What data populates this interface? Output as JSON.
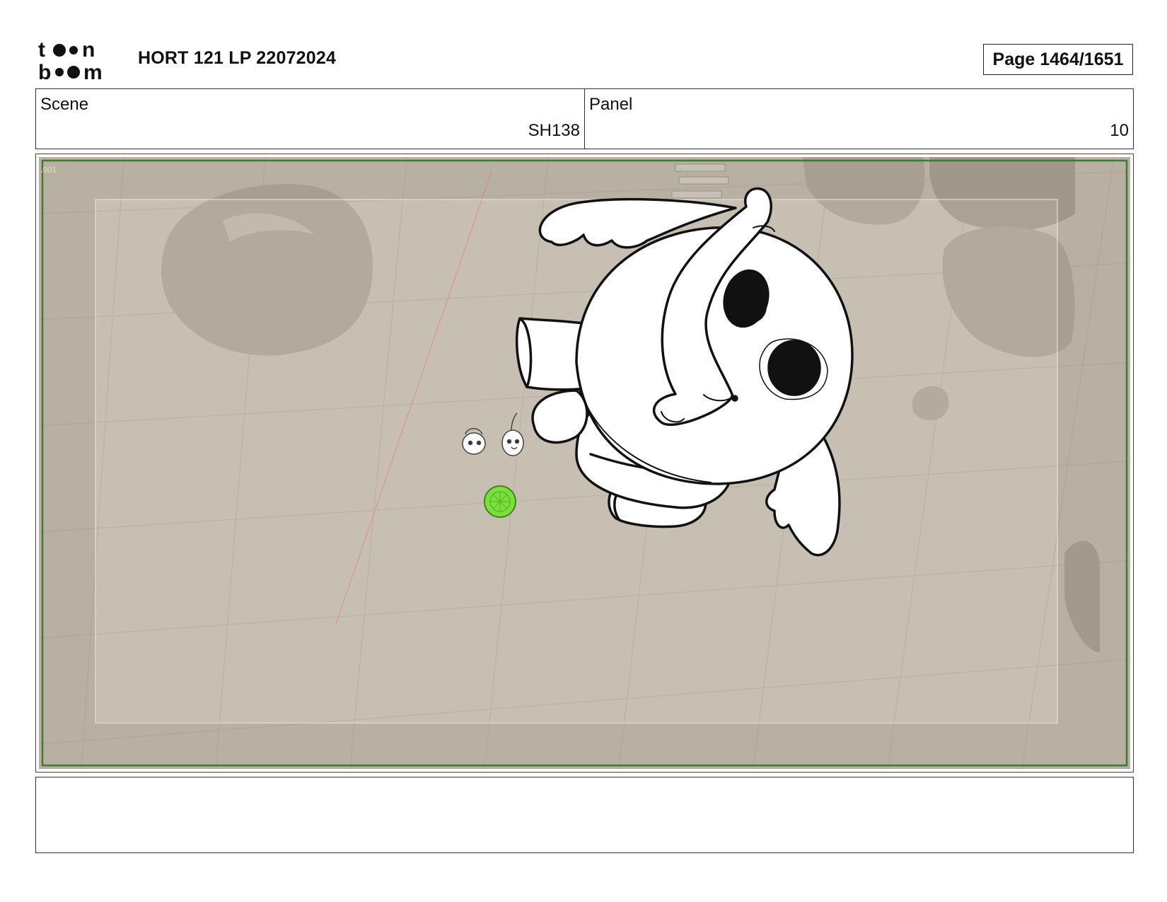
{
  "header": {
    "logo_text": "toonboom",
    "title": "HORT 121 LP 22072024",
    "page_label": "Page 1464/1651"
  },
  "info": {
    "scene_label": "Scene",
    "scene_value": "SH138",
    "panel_label": "Panel",
    "panel_value": "10"
  },
  "panel_image": {
    "camera_label": ".001",
    "colors": {
      "floor": "#ccc4b6",
      "safe_border": "#3f7a2f",
      "ball": "#7ddf3a"
    }
  },
  "notes": {
    "text": ""
  }
}
